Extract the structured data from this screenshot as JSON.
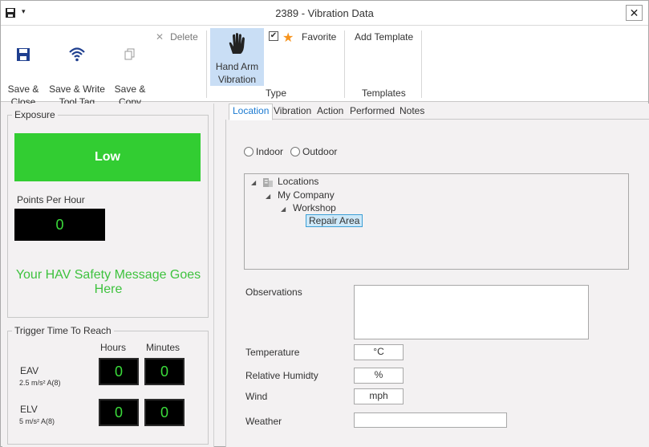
{
  "window": {
    "title": "2389 - Vibration Data",
    "close_glyph": "✕",
    "qat_dropdown_glyph": "▾"
  },
  "ribbon": {
    "save_close": "Save &\nClose",
    "save_write": "Save & Write\nTool Tag",
    "save_copy": "Save &\nCopy",
    "delete": "Delete",
    "hand_arm": "Hand Arm\nVibration",
    "favorite": "Favorite",
    "favorite_checked": true,
    "add_template": "Add Template",
    "group_type": "Type",
    "group_templates": "Templates",
    "accent": "#1f3f8f"
  },
  "exposure": {
    "legend": "Exposure",
    "level": "Low",
    "level_color": "#32cd32",
    "points_label": "Points Per Hour",
    "points_value": "0",
    "safety_message": "Your HAV Safety Message Goes Here"
  },
  "trigger": {
    "legend": "Trigger Time To Reach",
    "hours_label": "Hours",
    "minutes_label": "Minutes",
    "eav_label": "EAV",
    "eav_sub": "2.5 m/s² A(8)",
    "eav_hours": "0",
    "eav_minutes": "0",
    "elv_label": "ELV",
    "elv_sub": "5 m/s² A(8)",
    "elv_hours": "0",
    "elv_minutes": "0"
  },
  "tabs": [
    "Location",
    "Vibration",
    "Action",
    "Performed",
    "Notes"
  ],
  "location": {
    "indoor": "Indoor",
    "outdoor": "Outdoor",
    "tree": {
      "root": "Locations",
      "company": "My Company",
      "workshop": "Workshop",
      "area": "Repair Area"
    },
    "observations_label": "Observations",
    "observations_value": "",
    "temperature_label": "Temperature",
    "temperature_unit": "°C",
    "humidity_label": "Relative Humidty",
    "humidity_unit": "%",
    "wind_label": "Wind",
    "wind_unit": "mph",
    "weather_label": "Weather",
    "weather_value": ""
  }
}
